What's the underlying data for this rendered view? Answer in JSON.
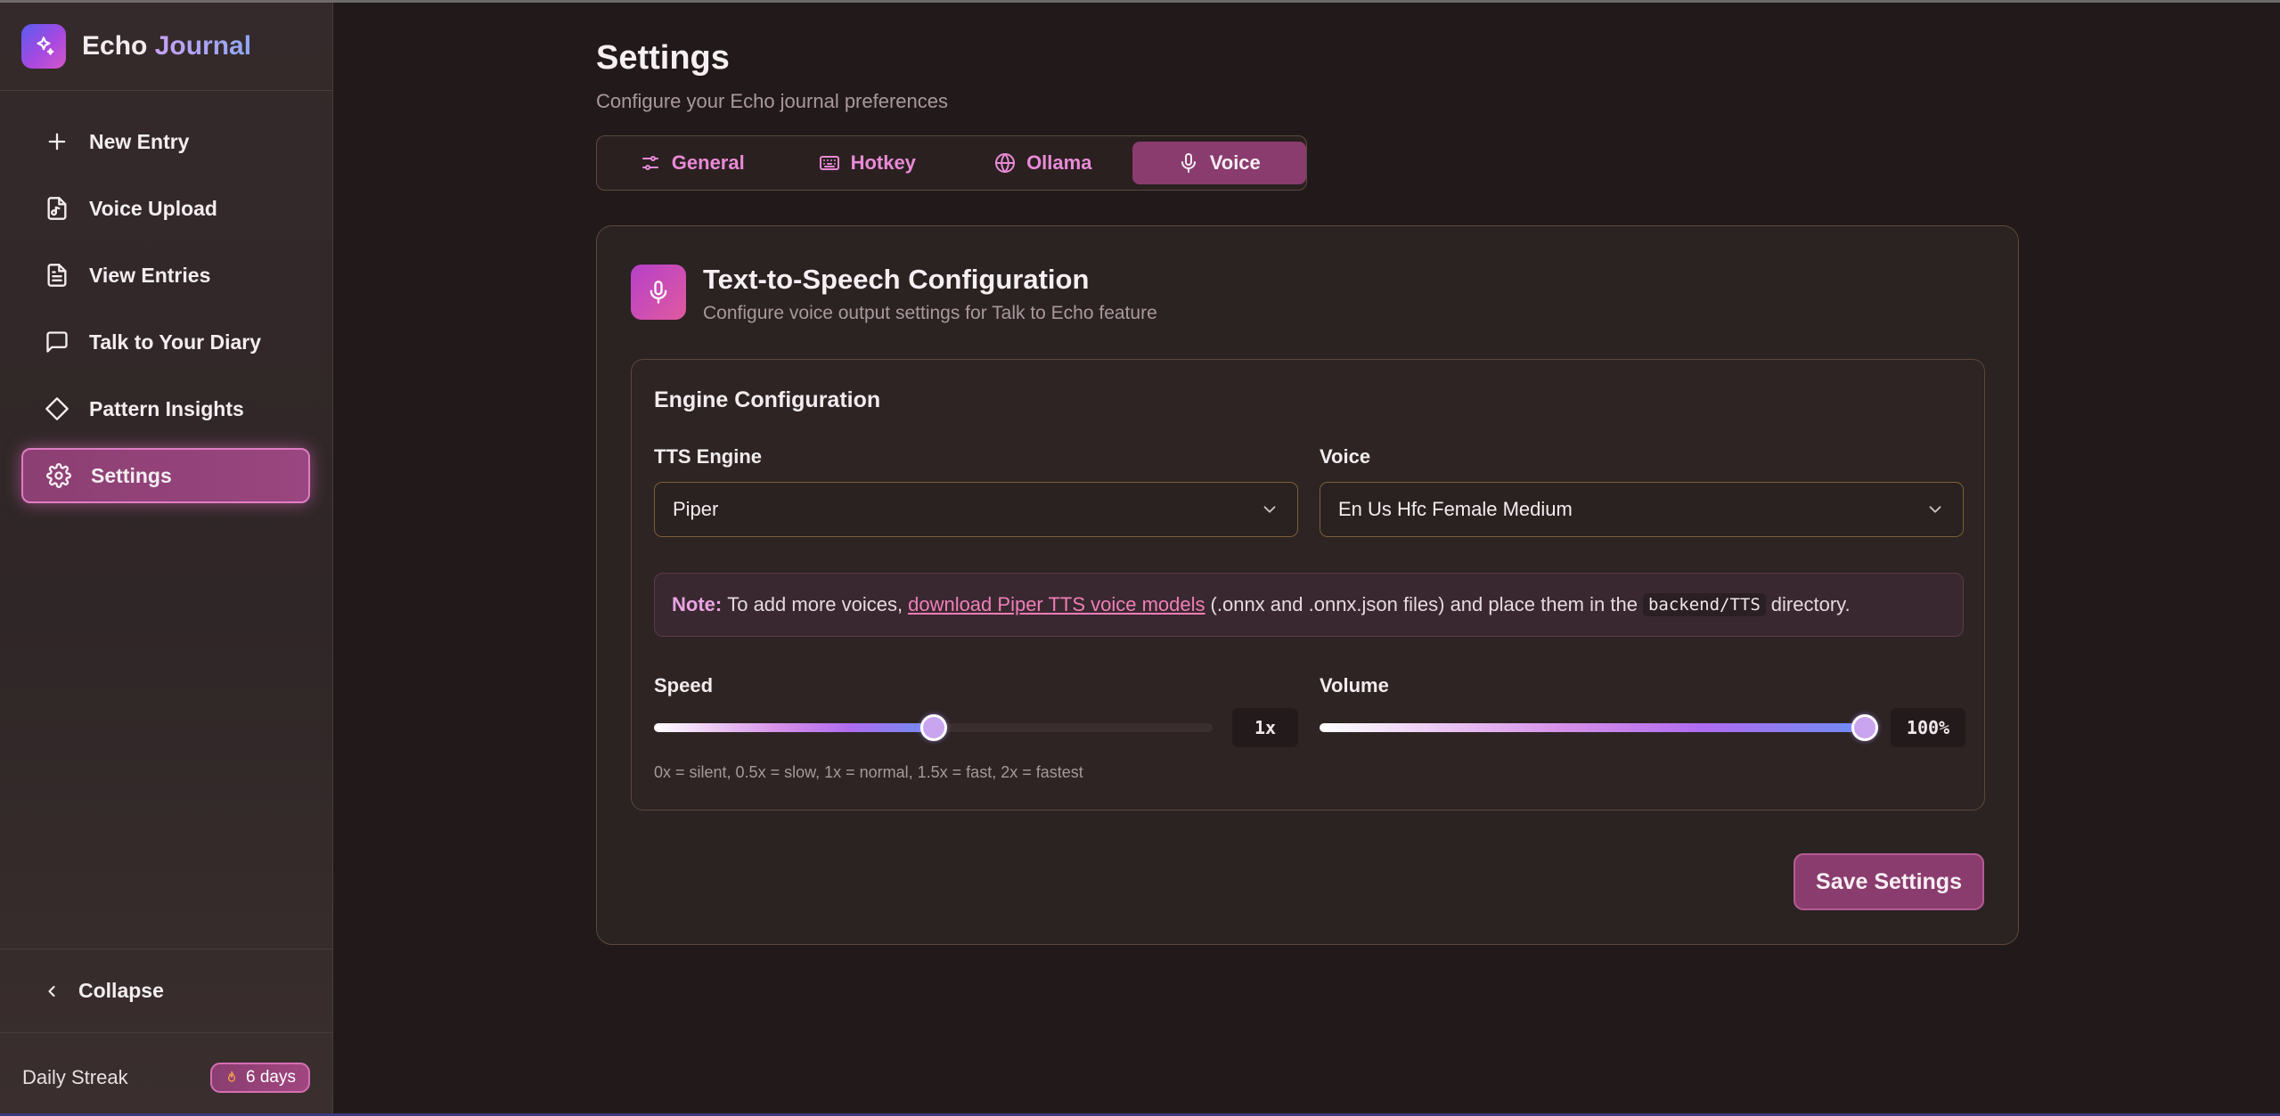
{
  "app": {
    "name_part1": "Echo",
    "name_part2": "Journal"
  },
  "sidebar": {
    "items": [
      {
        "label": "New Entry",
        "icon": "plus-icon"
      },
      {
        "label": "Voice Upload",
        "icon": "file-audio-icon"
      },
      {
        "label": "View Entries",
        "icon": "file-text-icon"
      },
      {
        "label": "Talk to Your Diary",
        "icon": "message-square-icon"
      },
      {
        "label": "Pattern Insights",
        "icon": "diamond-icon"
      },
      {
        "label": "Settings",
        "icon": "gear-icon",
        "active": true
      }
    ],
    "collapse_label": "Collapse",
    "streak_label": "Daily Streak",
    "streak_value": "6 days"
  },
  "header": {
    "title": "Settings",
    "subtitle": "Configure your Echo journal preferences"
  },
  "tabs": [
    {
      "label": "General",
      "icon": "sliders-icon"
    },
    {
      "label": "Hotkey",
      "icon": "keyboard-icon"
    },
    {
      "label": "Ollama",
      "icon": "globe-icon"
    },
    {
      "label": "Voice",
      "icon": "mic-icon",
      "active": true
    }
  ],
  "tts": {
    "title": "Text-to-Speech Configuration",
    "subtitle": "Configure voice output settings for Talk to Echo feature",
    "panel_title": "Engine Configuration",
    "engine_label": "TTS Engine",
    "engine_value": "Piper",
    "voice_label": "Voice",
    "voice_value": "En Us Hfc Female Medium",
    "note": {
      "bold": "Note:",
      "text1": "To add more voices,",
      "link": "download Piper TTS voice models",
      "text2": "(.onnx and .onnx.json files) and place them in the",
      "code": "backend/TTS",
      "text3": "directory."
    },
    "speed_label": "Speed",
    "speed_value": "1x",
    "speed_fraction": 0.5,
    "volume_label": "Volume",
    "volume_value": "100%",
    "volume_fraction": 1.0,
    "hint": "0x = silent, 0.5x = slow, 1x = normal, 1.5x = fast, 2x = fastest",
    "save_label": "Save Settings"
  },
  "colors": {
    "accent": "#8a3c6e",
    "accent_border": "#e07cc4",
    "tab_text": "#e98ad6",
    "background": "#221a1a"
  }
}
